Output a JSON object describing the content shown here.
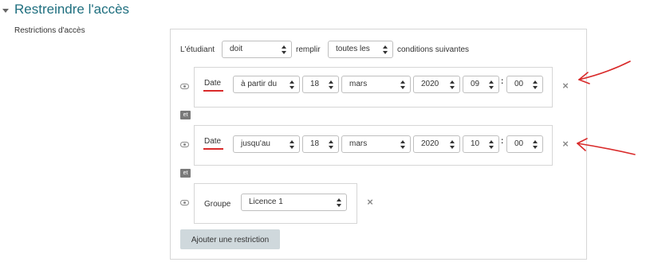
{
  "section": {
    "title": "Restreindre l'accès",
    "field_label": "Restrictions d'accès"
  },
  "header_row": {
    "student_label": "L'étudiant",
    "must_select": "doit",
    "fill_label": "remplir",
    "all_select": "toutes les",
    "conditions_label": "conditions suivantes"
  },
  "restriction1": {
    "type_label": "Date",
    "direction": "à partir du",
    "day": "18",
    "month": "mars",
    "year": "2020",
    "hour": "09",
    "minute": "00"
  },
  "restriction2": {
    "type_label": "Date",
    "direction": "jusqu'au",
    "day": "18",
    "month": "mars",
    "year": "2020",
    "hour": "10",
    "minute": "00"
  },
  "connector_label": "et",
  "time_separator": ":",
  "delete_glyph": "×",
  "restriction3": {
    "type_label": "Groupe",
    "group": "Licence 1"
  },
  "add_button": "Ajouter une restriction",
  "colors": {
    "title": "#1f6f7f",
    "annotation": "#d92a2a",
    "button_bg": "#cfd8dc"
  }
}
